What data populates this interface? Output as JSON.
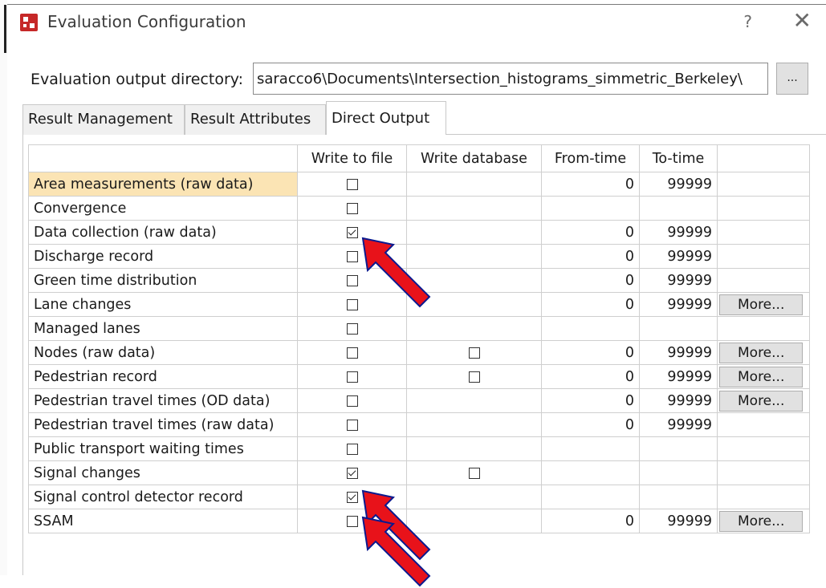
{
  "window": {
    "title": "Evaluation Configuration",
    "help_label": "?",
    "close_label": "✕"
  },
  "directory": {
    "label": "Evaluation output directory:",
    "value": "saracco6\\Documents\\Intersection_histograms_simmetric_Berkeley\\",
    "browse_label": "..."
  },
  "tabs": [
    {
      "label": "Result Management"
    },
    {
      "label": "Result Attributes"
    },
    {
      "label": "Direct Output"
    }
  ],
  "table": {
    "columns": [
      "",
      "Write to file",
      "Write database",
      "From-time",
      "To-time",
      ""
    ],
    "rows": [
      {
        "name": "Area measurements (raw data)",
        "file": false,
        "db": null,
        "from": "0",
        "to": "99999",
        "more": null
      },
      {
        "name": "Convergence",
        "file": false,
        "db": null,
        "from": "",
        "to": "",
        "more": null
      },
      {
        "name": "Data collection (raw data)",
        "file": true,
        "db": null,
        "from": "0",
        "to": "99999",
        "more": null
      },
      {
        "name": "Discharge record",
        "file": false,
        "db": null,
        "from": "0",
        "to": "99999",
        "more": null
      },
      {
        "name": "Green time distribution",
        "file": false,
        "db": null,
        "from": "0",
        "to": "99999",
        "more": null
      },
      {
        "name": "Lane changes",
        "file": false,
        "db": null,
        "from": "0",
        "to": "99999",
        "more": "More..."
      },
      {
        "name": "Managed lanes",
        "file": false,
        "db": null,
        "from": "",
        "to": "",
        "more": null
      },
      {
        "name": "Nodes (raw data)",
        "file": false,
        "db": false,
        "from": "0",
        "to": "99999",
        "more": "More..."
      },
      {
        "name": "Pedestrian record",
        "file": false,
        "db": false,
        "from": "0",
        "to": "99999",
        "more": "More..."
      },
      {
        "name": "Pedestrian travel times (OD data)",
        "file": false,
        "db": null,
        "from": "0",
        "to": "99999",
        "more": "More..."
      },
      {
        "name": "Pedestrian travel times (raw data)",
        "file": false,
        "db": null,
        "from": "0",
        "to": "99999",
        "more": null
      },
      {
        "name": "Public transport waiting times",
        "file": false,
        "db": null,
        "from": "",
        "to": "",
        "more": null
      },
      {
        "name": "Signal changes",
        "file": true,
        "db": false,
        "from": "",
        "to": "",
        "more": null
      },
      {
        "name": "Signal control detector record",
        "file": true,
        "db": null,
        "from": "",
        "to": "",
        "more": null
      },
      {
        "name": "SSAM",
        "file": false,
        "db": null,
        "from": "0",
        "to": "99999",
        "more": "More..."
      }
    ]
  },
  "colors": {
    "selected_row": "#fbe4b4",
    "annotation_arrow": "#e8121a",
    "app_icon": "#c62828"
  },
  "icons": [
    "app-icon",
    "help-icon",
    "close-icon",
    "checkbox-icon",
    "annotation-arrow"
  ]
}
